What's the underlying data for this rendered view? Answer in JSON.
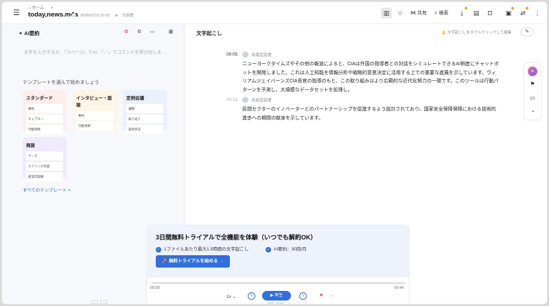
{
  "header": {
    "menu_icon": "hamburger-icon",
    "breadcrumb_home": "⌂ ホーム",
    "breadcrumb_sep": ">",
    "file_title": "today,news.m4a",
    "date": "2025/07/22 15:03",
    "language": "日本語",
    "share_label": "共有",
    "search_label": "検索"
  },
  "left": {
    "title": "AI要約",
    "input_placeholder": "文字を入力するか、「スペース」でAI、「／」でコマンドを呼び出しま…",
    "template_hint": "テンプレートを選んで始めましょう",
    "cards": [
      {
        "title": "スタンダード",
        "items": [
          "要約",
          "チャプター",
          "行動項目"
        ],
        "color": "#fdeeee"
      },
      {
        "title": "インタビュー・面接",
        "items": [
          "要約",
          "行動項目"
        ],
        "color": "#fdf5e6"
      },
      {
        "title": "定例会議",
        "items": [
          "議題",
          "振り返り",
          "進捗状況"
        ],
        "color": "#eaf1fd"
      },
      {
        "title": "商談",
        "items": [
          "テーマ",
          "ヒアリング内容",
          "提案内容概"
        ],
        "color": "#efeafd"
      }
    ],
    "all_templates": "すべてのテンプレート >"
  },
  "right": {
    "title": "文字起こし",
    "edit_hint": "文字起こしをダブルクリックして編集",
    "segments": [
      {
        "time": "00:05",
        "speaker": "未設定話者",
        "text": "ニューヨークタイムズやその他の報道によると、CIAは外国の指導者との対話をシミュレートできるAI側産にチャットボットを開発しました。これは人工知能を情報分析や戦略的意思決定に活用する上での重要な進展を示しています。ウィリアムジェイバーンズCIA長官の指導のもと、この取り組みはより広範的な近代化努力の一環です。このツールは行動パターンを予測し、大規模なデータセットを処理し。"
      },
      {
        "time": "00:31",
        "speaker": "未設定話者",
        "text": "民間セクターのイノベーターとのパートナーシップを促進するよう設計されており、国家安全保障保障における技術的進歩への期間の献身を示しています。"
      }
    ]
  },
  "trial": {
    "title": "3日間無料トライアルで全機能を体験（いつでも解約OK）",
    "feature_1": "1ファイルあたり最大1.5時間の文字起こし",
    "feature_2": "AI要約：30回/月",
    "button": "🚀 無料トライアルを始める →"
  },
  "player": {
    "current_time": "00:00",
    "total_time": "00:44",
    "progress": 0,
    "speed": "1x ⌄",
    "play_label": "▶ 再生",
    "shortcut": "Shift + Space",
    "skip_back": "5",
    "skip_forward": "5",
    "more": "⌄"
  },
  "colors": {
    "accent": "#2f6fdf",
    "left_panel_bg": "#f7f8fb",
    "trial_bg": "#eef2fb",
    "notify_dot": "#f5a524"
  }
}
